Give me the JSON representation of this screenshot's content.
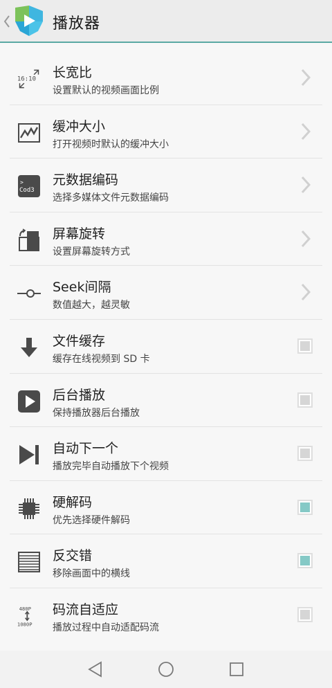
{
  "app_bar": {
    "title": "播放器",
    "logo_icon": "player-logo-icon",
    "back_icon": "back-chevron-icon",
    "accent_color": "#5aa9a3"
  },
  "settings": [
    {
      "title": "长宽比",
      "subtitle": "设置默认的视频画面比例",
      "icon": "aspect-ratio-icon",
      "icon_text": "16:10",
      "control": "chevron"
    },
    {
      "title": "缓冲大小",
      "subtitle": "打开视频时默认的缓冲大小",
      "icon": "chart-icon",
      "control": "chevron"
    },
    {
      "title": "元数据编码",
      "subtitle": "选择多媒体文件元数据编码",
      "icon": "code-icon",
      "icon_text": "Cod3",
      "control": "chevron"
    },
    {
      "title": "屏幕旋转",
      "subtitle": "设置屏幕旋转方式",
      "icon": "rotate-screen-icon",
      "control": "chevron"
    },
    {
      "title": "Seek间隔",
      "subtitle": "数值越大，越灵敏",
      "icon": "seek-slider-icon",
      "control": "chevron"
    },
    {
      "title": "文件缓存",
      "subtitle": "缓存在线视频到 SD 卡",
      "icon": "download-icon",
      "control": "checkbox",
      "checked": false
    },
    {
      "title": "后台播放",
      "subtitle": "保持播放器后台播放",
      "icon": "play-icon",
      "control": "checkbox",
      "checked": false
    },
    {
      "title": "自动下一个",
      "subtitle": "播放完毕自动播放下个视频",
      "icon": "skip-next-icon",
      "control": "checkbox",
      "checked": false
    },
    {
      "title": "硬解码",
      "subtitle": "优先选择硬件解码",
      "icon": "chip-icon",
      "control": "checkbox",
      "checked": true
    },
    {
      "title": "反交错",
      "subtitle": "移除画面中的横线",
      "icon": "deinterlace-icon",
      "control": "checkbox",
      "checked": true
    },
    {
      "title": "码流自适应",
      "subtitle": "播放过程中自动适配码流",
      "icon": "adaptive-bitrate-icon",
      "icon_text_top": "480P",
      "icon_text_bottom": "1080P",
      "control": "checkbox",
      "checked": false
    }
  ],
  "colors": {
    "checkbox_on": "#85c9c6",
    "checkbox_off": "#d6d6d6",
    "icon": "#4a4a4a",
    "chevron": "#d0d0d0"
  },
  "nav_bar": {
    "back_icon": "nav-back-icon",
    "home_icon": "nav-home-icon",
    "recents_icon": "nav-recents-icon"
  }
}
